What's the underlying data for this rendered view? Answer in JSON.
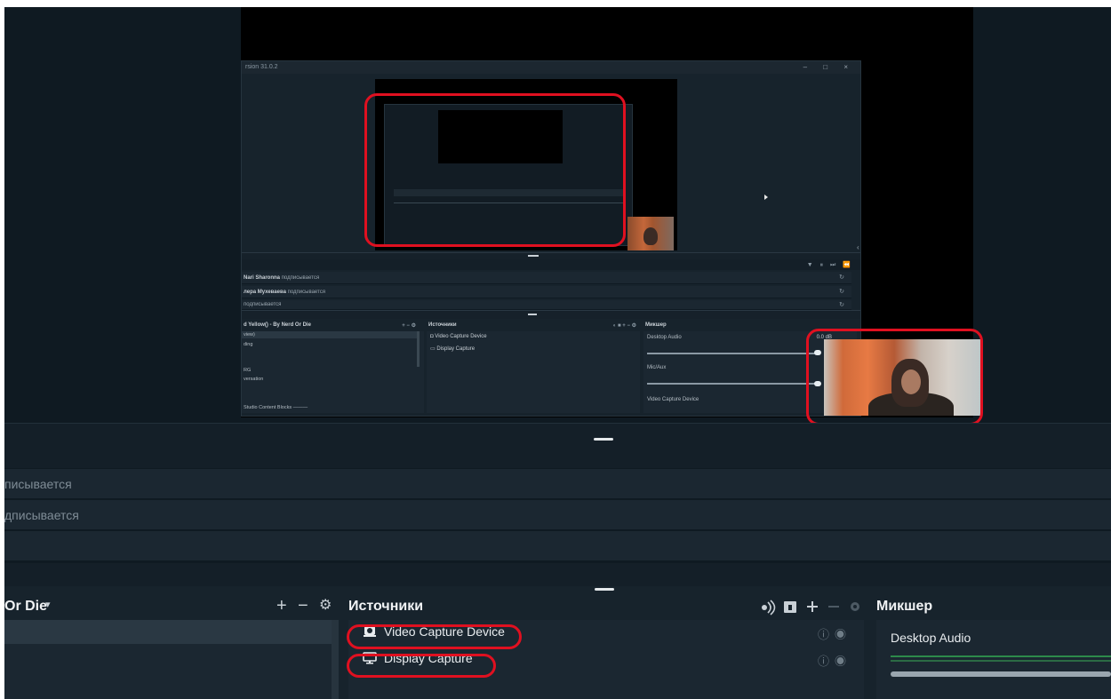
{
  "nested": {
    "title": "rsion 31.0.2",
    "window_controls": "– □ ×",
    "chat_controls": "▼ ⏸ ⏭ ⏪",
    "chat_rows": [
      {
        "name": "Nari Sharonna",
        "status": "подписывается"
      },
      {
        "name": "лера Мухеваева",
        "status": "подписывается"
      },
      {
        "name": "",
        "status": "подписывается"
      }
    ],
    "scenes_title": "d Yellow() - By Nerd Or Die",
    "scenes_items": [
      "view)",
      "ding",
      "",
      "",
      "RG",
      "versation",
      "",
      "Studio Content Blocks ———"
    ],
    "sources_title": "Источники",
    "sources_items": [
      "Video Capture Device",
      "Display Capture"
    ],
    "mixer_title": "Микшер",
    "mixer_items": [
      {
        "label": "Desktop Audio",
        "db": "0.0 dB"
      },
      {
        "label": "Mic/Aux",
        "db": ""
      },
      {
        "label": "Video Capture Device",
        "db": ""
      }
    ]
  },
  "chat": {
    "rows": [
      "писывается",
      "дписывается",
      ""
    ]
  },
  "scenes": {
    "title": "Or Die",
    "chevron": "▾",
    "add": "+",
    "remove": "−",
    "settings": "⚙"
  },
  "sources": {
    "title": "Источники",
    "items": [
      {
        "label": "Video Capture Device",
        "icon": "webcam-icon"
      },
      {
        "label": "Display Capture",
        "icon": "monitor-icon"
      }
    ]
  },
  "mixer": {
    "title": "Микшер",
    "items": [
      {
        "label": "Desktop Audio"
      }
    ]
  },
  "colors": {
    "highlight": "#e01020",
    "background": "#0f1a22",
    "panel": "#1b2731"
  }
}
